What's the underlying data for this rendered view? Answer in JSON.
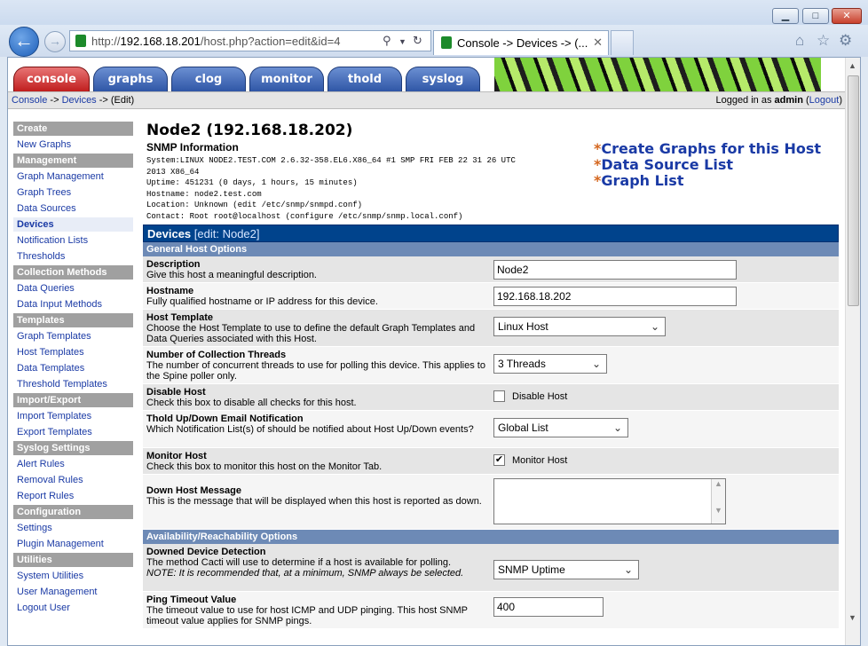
{
  "browser": {
    "url_prefix": "http://",
    "url_host": "192.168.18.201",
    "url_path": "/host.php?action=edit&id=4",
    "tab_title": "Console -> Devices -> (...",
    "minimize": "▁",
    "maximize": "□",
    "close": "✕"
  },
  "cacti_tabs": [
    "console",
    "graphs",
    "clog",
    "monitor",
    "thold",
    "syslog"
  ],
  "breadcrumb": {
    "console": "Console",
    "sep1": " -> ",
    "devices": "Devices",
    "rest": " -> (Edit)"
  },
  "login": {
    "prefix": "Logged in as ",
    "user": "admin",
    "open": " (",
    "logout": "Logout",
    "close": ")"
  },
  "sidebar": [
    {
      "type": "head",
      "label": "Create"
    },
    {
      "type": "item",
      "label": "New Graphs"
    },
    {
      "type": "head",
      "label": "Management"
    },
    {
      "type": "item",
      "label": "Graph Management"
    },
    {
      "type": "item",
      "label": "Graph Trees"
    },
    {
      "type": "item",
      "label": "Data Sources"
    },
    {
      "type": "item",
      "label": "Devices",
      "active": true
    },
    {
      "type": "item",
      "label": "Notification Lists"
    },
    {
      "type": "item",
      "label": "Thresholds"
    },
    {
      "type": "head",
      "label": "Collection Methods"
    },
    {
      "type": "item",
      "label": "Data Queries"
    },
    {
      "type": "item",
      "label": "Data Input Methods"
    },
    {
      "type": "head",
      "label": "Templates"
    },
    {
      "type": "item",
      "label": "Graph Templates"
    },
    {
      "type": "item",
      "label": "Host Templates"
    },
    {
      "type": "item",
      "label": "Data Templates"
    },
    {
      "type": "item",
      "label": "Threshold Templates"
    },
    {
      "type": "head",
      "label": "Import/Export"
    },
    {
      "type": "item",
      "label": "Import Templates"
    },
    {
      "type": "item",
      "label": "Export Templates"
    },
    {
      "type": "head",
      "label": "Syslog Settings"
    },
    {
      "type": "item",
      "label": "Alert Rules"
    },
    {
      "type": "item",
      "label": "Removal Rules"
    },
    {
      "type": "item",
      "label": "Report Rules"
    },
    {
      "type": "head",
      "label": "Configuration"
    },
    {
      "type": "item",
      "label": "Settings"
    },
    {
      "type": "item",
      "label": "Plugin Management"
    },
    {
      "type": "head",
      "label": "Utilities"
    },
    {
      "type": "item",
      "label": "System Utilities"
    },
    {
      "type": "item",
      "label": "User Management"
    },
    {
      "type": "item",
      "label": "Logout User"
    }
  ],
  "host": {
    "title": "Node2 (192.168.18.202)",
    "snmp_title": "SNMP Information",
    "snmp_lines": "System:LINUX NODE2.TEST.COM 2.6.32-358.EL6.X86_64 #1 SMP FRI FEB 22 31 26 UTC\n2013 X86_64\nUptime: 451231 (0 days, 1 hours, 15 minutes)\nHostname: node2.test.com\nLocation: Unknown (edit /etc/snmp/snmpd.conf)\nContact: Root root@localhost (configure /etc/snmp/snmp.local.conf)"
  },
  "quick_links": [
    {
      "star": "*",
      "label": "Create Graphs for this Host"
    },
    {
      "star": "*",
      "label": "Data Source List"
    },
    {
      "star": "*",
      "label": "Graph List"
    }
  ],
  "form": {
    "header_title": "Devices",
    "header_sub": "[edit: Node2]",
    "section1": "General Host Options",
    "section2": "Availability/Reachability Options",
    "rows": {
      "description": {
        "title": "Description",
        "help": "Give this host a meaningful description.",
        "value": "Node2"
      },
      "hostname": {
        "title": "Hostname",
        "help": "Fully qualified hostname or IP address for this device.",
        "value": "192.168.18.202"
      },
      "host_template": {
        "title": "Host Template",
        "help": "Choose the Host Template to use to define the default Graph Templates and Data Queries associated with this Host.",
        "value": "Linux Host"
      },
      "threads": {
        "title": "Number of Collection Threads",
        "help": "The number of concurrent threads to use for polling this device. This applies to the Spine poller only.",
        "value": "3 Threads"
      },
      "disable": {
        "title": "Disable Host",
        "help": "Check this box to disable all checks for this host.",
        "label": "Disable Host",
        "checked": "false"
      },
      "thold": {
        "title": "Thold Up/Down Email Notification",
        "help": "Which Notification List(s) of should be notified about Host Up/Down events?",
        "value": "Global List"
      },
      "monitor": {
        "title": "Monitor Host",
        "help": "Check this box to monitor this host on the Monitor Tab.",
        "label": "Monitor Host",
        "checked": "true"
      },
      "down_msg": {
        "title": "Down Host Message",
        "help": "This is the message that will be displayed when this host is reported as down.",
        "value": ""
      },
      "downed": {
        "title": "Downed Device Detection",
        "help": "The method Cacti will use to determine if a host is available for polling.",
        "note": "NOTE: It is recommended that, at a minimum, SNMP always be selected.",
        "value": "SNMP Uptime"
      },
      "ping_timeout": {
        "title": "Ping Timeout Value",
        "help": "The timeout value to use for host ICMP and UDP pinging. This host SNMP timeout value applies for SNMP pings.",
        "value": "400"
      }
    }
  },
  "icons": {
    "back": "arrow-left-icon",
    "forward": "arrow-right-icon",
    "search": "search-icon",
    "refresh": "refresh-icon",
    "home": "home-icon",
    "star": "star-icon",
    "gear": "gear-icon"
  }
}
